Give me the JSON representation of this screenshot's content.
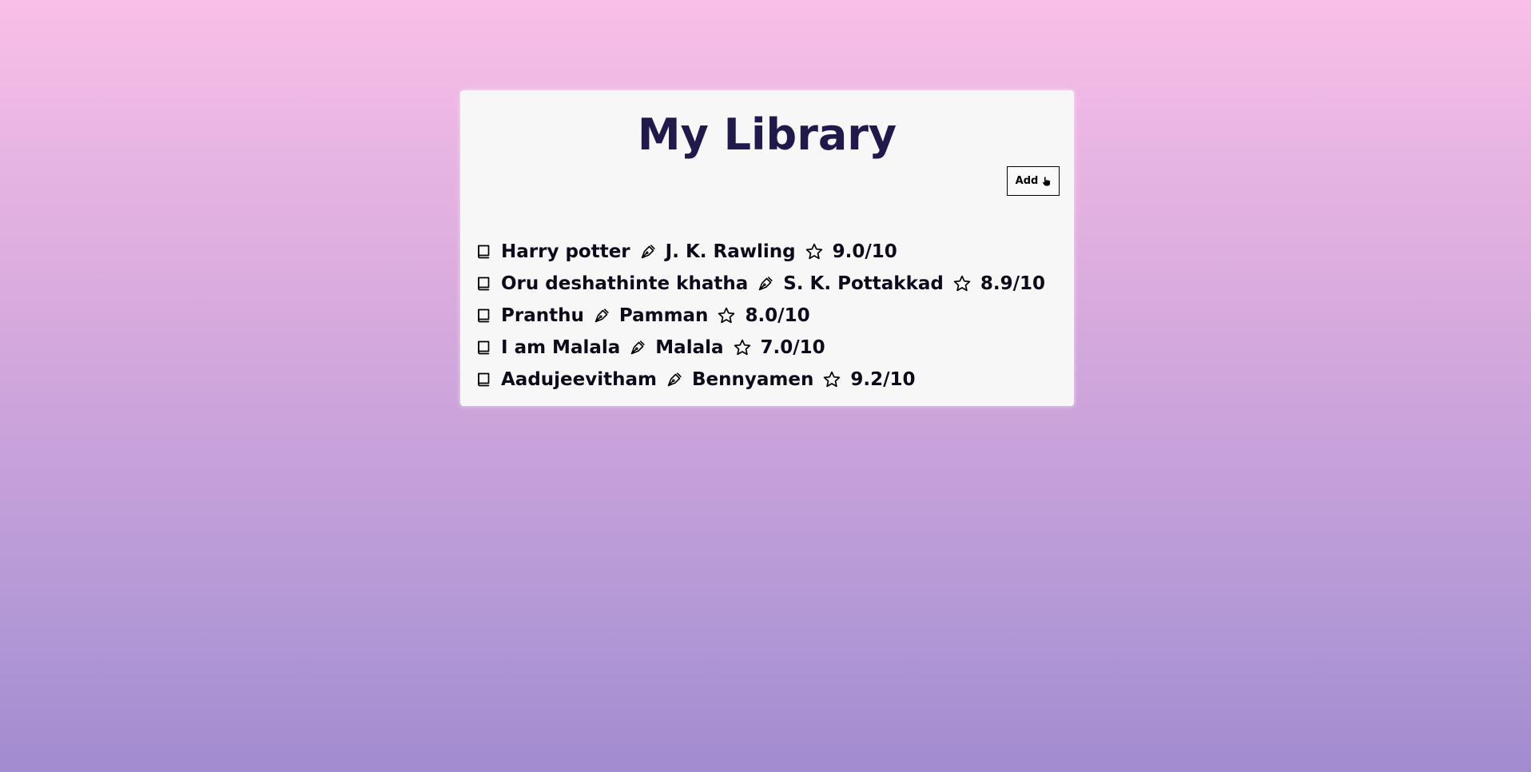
{
  "page": {
    "title": "My Library",
    "add_button": {
      "label": "Add",
      "icon": "pointing-hand-icon"
    }
  },
  "icons": {
    "book": "book-icon",
    "author": "pen-nib-icon",
    "rating": "star-icon"
  },
  "books": [
    {
      "title": "Harry potter",
      "author": "J. K. Rawling",
      "rating": "9.0/10"
    },
    {
      "title": "Oru deshathinte khatha",
      "author": "S. K. Pottakkad",
      "rating": "8.9/10"
    },
    {
      "title": "Pranthu",
      "author": "Pamman",
      "rating": "8.0/10"
    },
    {
      "title": "I am Malala",
      "author": "Malala",
      "rating": "7.0/10"
    },
    {
      "title": "Aadujeevitham",
      "author": "Bennyamen",
      "rating": "9.2/10"
    }
  ],
  "colors": {
    "title": "#1f1a4a",
    "card": "#f8f7f8",
    "gradient_top": "#f9bfe8",
    "gradient_bottom": "#a28bd0"
  }
}
